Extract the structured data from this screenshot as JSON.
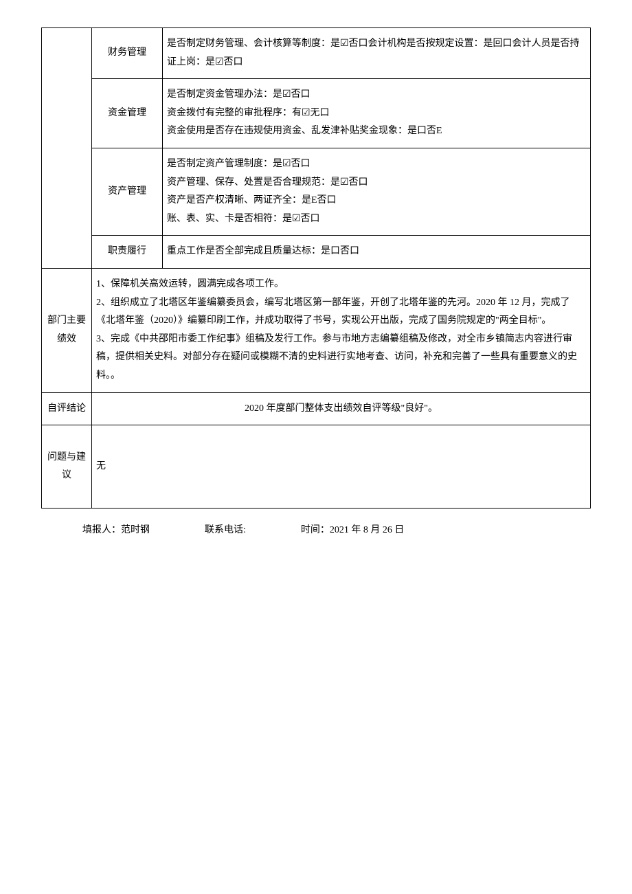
{
  "rows": [
    {
      "label": "财务管理",
      "content": "是否制定财务管理、会计核算等制度：是☑否口会计机构是否按规定设置：是回口会计人员是否持证上岗：是☑否口"
    },
    {
      "label": "资金管理",
      "content": "是否制定资金管理办法：是☑否口\n资金拨付有完整的审批程序：有☑无口\n资金使用是否存在违规使用资金、乱发津补贴奖金现象：是口否E"
    },
    {
      "label": "资产管理",
      "content": "是否制定资产管理制度：是☑否口\n资产管理、保存、处置是否合理规范：是☑否口\n资产是否产权清晰、两证齐全：是E否口\n账、表、实、卡是否相符：是☑否口"
    },
    {
      "label": "职责履行",
      "content": "重点工作是否全部完成且质量达标：是口否口"
    }
  ],
  "sections": {
    "dept_results": {
      "label": "部门主要绩效",
      "content": "1、保障机关高效运转，圆满完成各项工作。\n2、组织成立了北塔区年鉴编纂委员会，编写北塔区第一部年鉴，开创了北塔年鉴的先河。2020 年 12 月，完成了《北塔年鉴（2020）》编纂印刷工作，并成功取得了书号，实现公开出版，完成了国务院规定的\"两全目标\"。\n3、完成《中共邵阳市委工作纪事》组稿及发行工作。参与市地方志编纂组稿及修改，对全市乡镇简志内容进行审稿，提供相关史料。对部分存在疑问或模糊不清的史料进行实地考查、访问，补充和完善了一些具有重要意义的史料。。"
    },
    "self_eval": {
      "label": "自评结论",
      "content": "2020 年度部门整体支出绩效自评等级\"良好\"。"
    },
    "issues": {
      "label": "问题与建议",
      "content": "无"
    }
  },
  "footer": {
    "reporter_label": "填报人：",
    "reporter": "范时钢",
    "phone_label": "联系电话:",
    "phone": "",
    "time_label": "时间：",
    "time": "2021 年 8 月 26 日"
  }
}
